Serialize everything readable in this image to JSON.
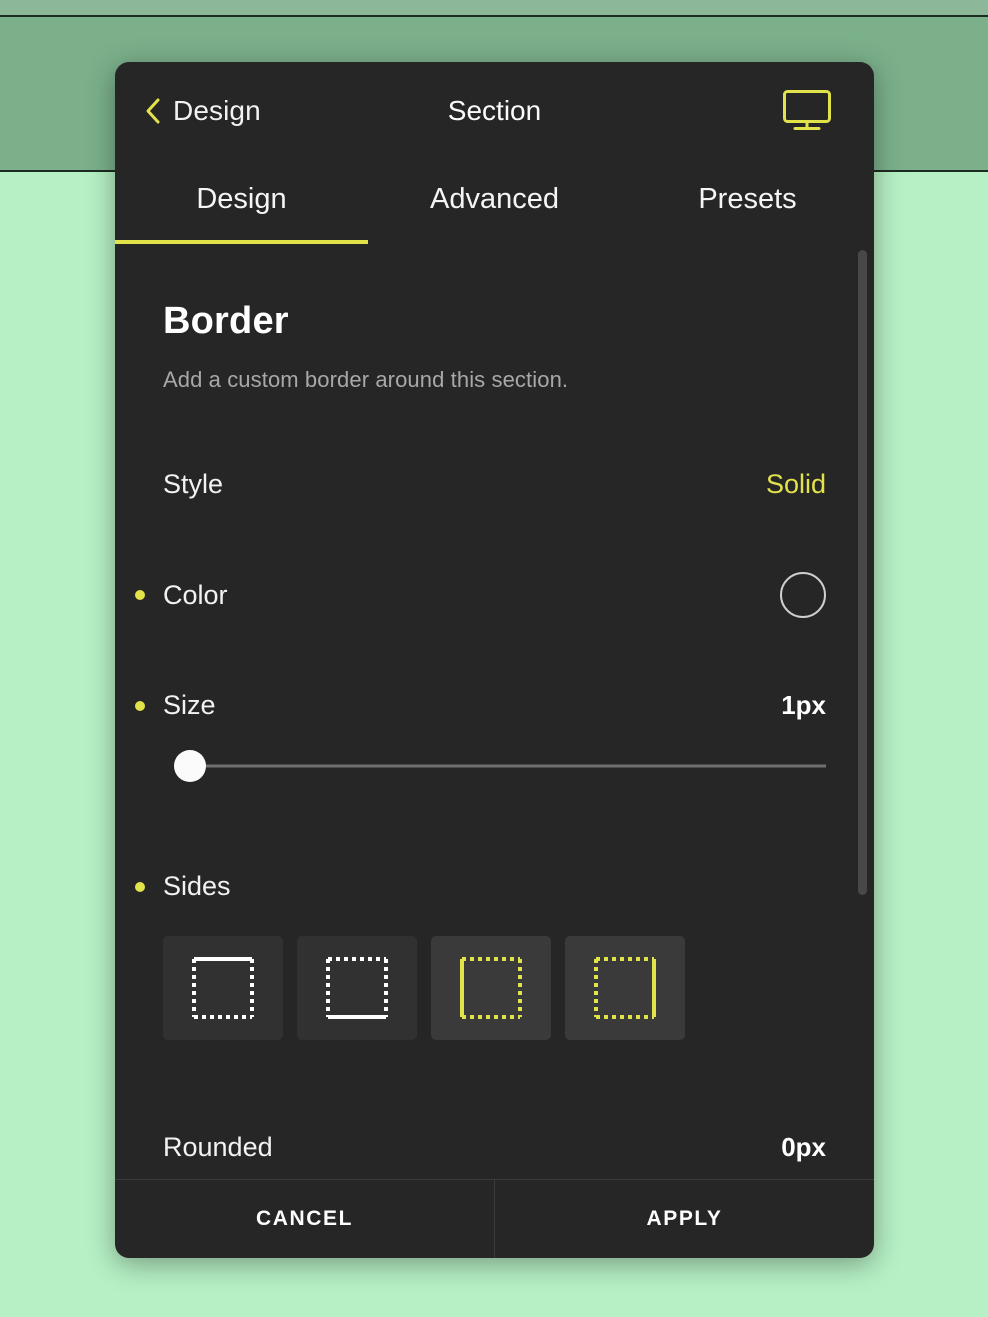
{
  "background": {
    "band_color": "#7bb08b",
    "page_color": "#b6f0c4"
  },
  "theme": {
    "accent": "#e2e24b",
    "panel_bg": "#262626",
    "text": "#f2f2f2",
    "muted_text": "#a8a8a8"
  },
  "topbar": {
    "back_label": "Design",
    "title": "Section",
    "back_icon": "chevron-left-icon",
    "device_icon": "desktop-monitor-icon"
  },
  "tabs": [
    {
      "label": "Design",
      "active": true
    },
    {
      "label": "Advanced",
      "active": false
    },
    {
      "label": "Presets",
      "active": false
    }
  ],
  "border_section": {
    "title": "Border",
    "description": "Add a custom border around this section.",
    "style": {
      "label": "Style",
      "value": "Solid"
    },
    "color": {
      "label": "Color",
      "swatch_fill": "transparent",
      "swatch_stroke": "#cfcfcf"
    },
    "size": {
      "label": "Size",
      "value": "1px",
      "slider_percent": 2
    },
    "sides": {
      "label": "Sides",
      "options": [
        {
          "name": "border-top-option",
          "solid_side": "top",
          "selected": false,
          "color": "#ffffff"
        },
        {
          "name": "border-bottom-option",
          "solid_side": "bottom",
          "selected": false,
          "color": "#ffffff"
        },
        {
          "name": "border-left-option",
          "solid_side": "left",
          "selected": true,
          "color": "#e2e24b"
        },
        {
          "name": "border-right-option",
          "solid_side": "right",
          "selected": true,
          "color": "#e2e24b"
        }
      ]
    },
    "rounded": {
      "label": "Rounded",
      "value": "0px",
      "slider_percent": 0
    }
  },
  "footer": {
    "cancel_label": "CANCEL",
    "apply_label": "APPLY"
  }
}
